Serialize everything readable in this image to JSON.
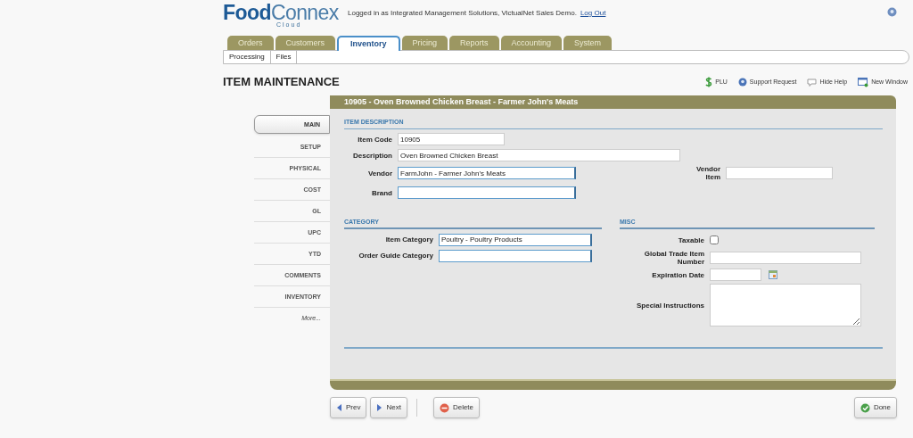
{
  "header": {
    "logo": {
      "part_1": "Food",
      "part_2": "Connex",
      "part_3": "Cloud"
    },
    "login_text": "Logged in as Integrated Management Solutions, VictualNet Sales Demo.",
    "logout_link": "Log Out"
  },
  "tabs": [
    {
      "label": "Orders",
      "selected": false
    },
    {
      "label": "Customers",
      "selected": false
    },
    {
      "label": "Inventory",
      "selected": true
    },
    {
      "label": "Pricing",
      "selected": false
    },
    {
      "label": "Reports",
      "selected": false
    },
    {
      "label": "Accounting",
      "selected": false
    },
    {
      "label": "System",
      "selected": false
    }
  ],
  "subtabs": [
    {
      "label": "Processing"
    },
    {
      "label": "Files"
    }
  ],
  "page_title": "ITEM MAINTENANCE",
  "toolbar": [
    {
      "kind": "plu",
      "label": "PLU"
    },
    {
      "kind": "support",
      "label": "Support Request"
    },
    {
      "kind": "help",
      "label": "Hide Help"
    },
    {
      "kind": "window",
      "label": "New Window"
    }
  ],
  "record_title": "10905 - Oven Browned Chicken Breast - Farmer John's Meats",
  "side_nav": [
    {
      "label": "MAIN",
      "selected": true
    },
    {
      "label": "SETUP",
      "selected": false
    },
    {
      "label": "PHYSICAL",
      "selected": false
    },
    {
      "label": "COST",
      "selected": false
    },
    {
      "label": "GL",
      "selected": false
    },
    {
      "label": "UPC",
      "selected": false
    },
    {
      "label": "YTD",
      "selected": false
    },
    {
      "label": "COMMENTS",
      "selected": false
    },
    {
      "label": "INVENTORY",
      "selected": false
    },
    {
      "label": "More...",
      "selected": false
    }
  ],
  "item_description": {
    "heading": "ITEM DESCRIPTION",
    "fields": [
      {
        "kind": "short",
        "label": "Item Code",
        "value": "10905"
      },
      {
        "kind": "long",
        "label": "Description",
        "value": "Oven Browned Chicken Breast"
      },
      {
        "kind": "lookup",
        "label": "Vendor",
        "value": "FarmJohn - Farmer John's Meats"
      },
      {
        "kind": "lookup",
        "label": "Brand"
      }
    ],
    "vendor_item": {
      "label": "Vendor Item"
    }
  },
  "category": {
    "heading": "CATEGORY",
    "fields": [
      {
        "label": "Item Category",
        "value": "Poultry - Poultry Products"
      },
      {
        "label": "Order Guide Category"
      }
    ]
  },
  "misc": {
    "heading": "MISC",
    "fields": [
      {
        "kind": "checkbox",
        "label": "Taxable",
        "checked": false
      },
      {
        "kind": "text",
        "label": "Global Trade Item Number"
      },
      {
        "kind": "date",
        "label": "Expiration Date"
      },
      {
        "kind": "textarea",
        "label": "Special Instructions"
      }
    ]
  },
  "buttons": [
    {
      "kind": "prev",
      "label": "Prev"
    },
    {
      "kind": "next",
      "label": "Next"
    },
    {
      "kind": "delete",
      "label": "Delete"
    },
    {
      "kind": "done",
      "label": "Done"
    }
  ]
}
